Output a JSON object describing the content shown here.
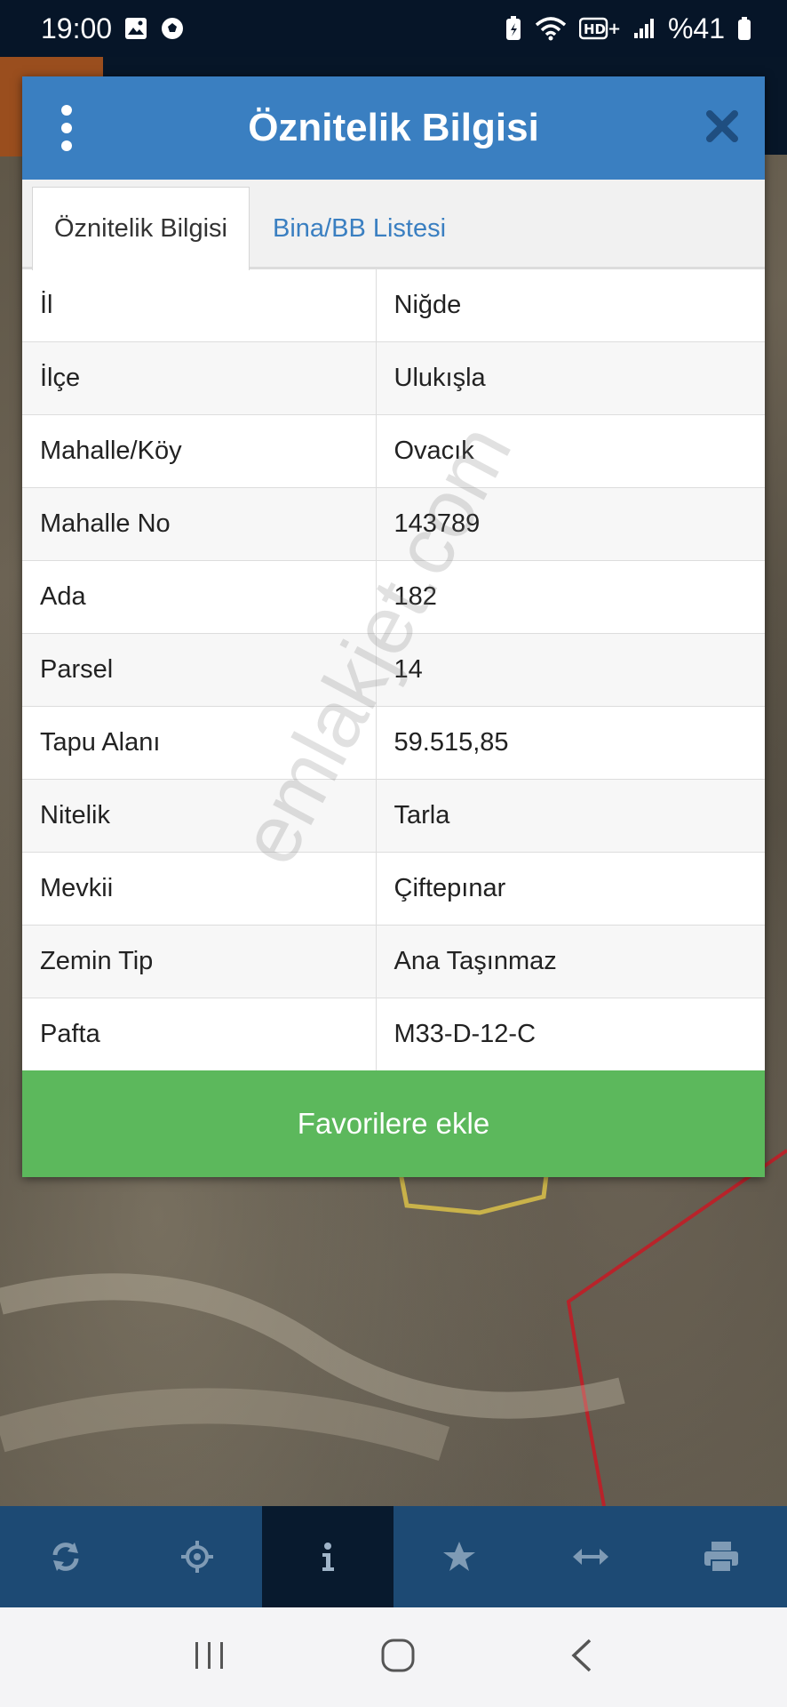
{
  "status_bar": {
    "time": "19:00",
    "battery": "%41",
    "icons": [
      "image-icon",
      "soccer-ball-icon",
      "battery-saver-icon",
      "wifi-icon",
      "hd-plus-icon",
      "signal-icon",
      "battery-icon"
    ]
  },
  "dialog": {
    "title": "Öznitelik Bilgisi",
    "tabs": [
      {
        "label": "Öznitelik Bilgisi",
        "active": true
      },
      {
        "label": "Bina/BB Listesi",
        "active": false
      }
    ],
    "rows": [
      {
        "key": "İl",
        "value": "Niğde"
      },
      {
        "key": "İlçe",
        "value": "Ulukışla"
      },
      {
        "key": "Mahalle/Köy",
        "value": "Ovacık"
      },
      {
        "key": "Mahalle No",
        "value": "143789"
      },
      {
        "key": "Ada",
        "value": "182"
      },
      {
        "key": "Parsel",
        "value": "14"
      },
      {
        "key": "Tapu Alanı",
        "value": "59.515,85"
      },
      {
        "key": "Nitelik",
        "value": "Tarla"
      },
      {
        "key": "Mevkii",
        "value": "Çiftepınar"
      },
      {
        "key": "Zemin Tip",
        "value": "Ana Taşınmaz"
      },
      {
        "key": "Pafta",
        "value": "M33-D-12-C"
      }
    ],
    "favorite_button": "Favorilere ekle"
  },
  "watermark": "emlakjet.com",
  "toolbar": {
    "items": [
      "refresh-icon",
      "crosshair-icon",
      "info-icon",
      "star-icon",
      "measure-icon",
      "print-icon"
    ],
    "active_index": 2
  },
  "colors": {
    "header": "#3a7fc1",
    "favorite": "#5cb85c",
    "toolbar": "#1d4a74",
    "toolbar_active": "#081a2e"
  }
}
